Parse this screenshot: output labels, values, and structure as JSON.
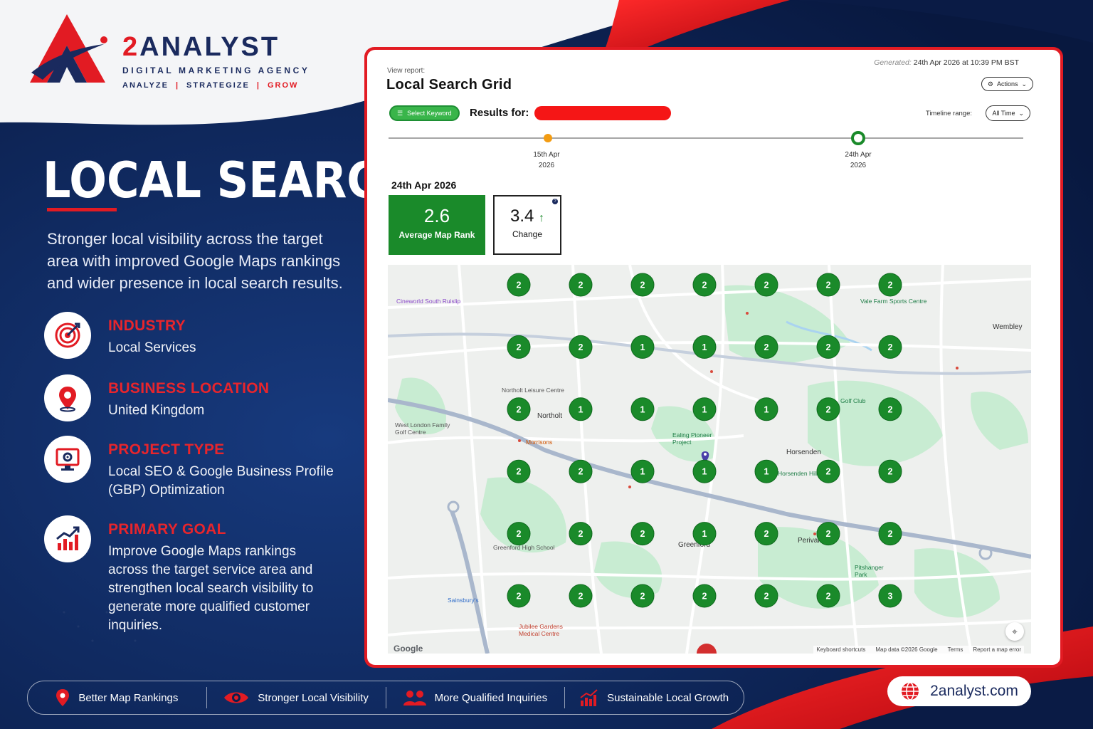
{
  "brand": {
    "name_prefix": "2",
    "name": "ANALYST",
    "subtitle": "DIGITAL MARKETING AGENCY",
    "tagline": [
      "ANALYZE",
      "STRATEGIZE",
      "GROW"
    ]
  },
  "headline": "LOCAL SEARCH GRID",
  "lead": "Stronger local visibility across the target area with improved Google Maps rankings and wider presence in local search results.",
  "info": [
    {
      "title": "INDUSTRY",
      "body": "Local Services",
      "icon": "target-icon"
    },
    {
      "title": "BUSINESS LOCATION",
      "body": "United Kingdom",
      "icon": "location-pin-icon"
    },
    {
      "title": "PROJECT TYPE",
      "body": "Local SEO & Google Business Profile (GBP) Optimization",
      "icon": "monitor-gear-icon"
    },
    {
      "title": "PRIMARY GOAL",
      "body": "Improve Google Maps rankings across the target service area and strengthen local search visibility to generate more qualified customer inquiries.",
      "icon": "growth-chart-icon"
    }
  ],
  "report": {
    "view_report_label": "View report:",
    "title": "Local Search Grid",
    "generated_label": "Generated:",
    "generated_value": "24th Apr 2026 at 10:39 PM BST",
    "actions_label": "Actions",
    "select_keyword_label": "Select Keyword",
    "results_for_label": "Results for:",
    "timeline_range_label": "Timeline range:",
    "timeline_range_value": "All Time",
    "timeline": [
      {
        "day": "15th Apr",
        "year": "2026",
        "color": "#f39c12"
      },
      {
        "day": "24th Apr",
        "year": "2026",
        "color": "#1a8a2a"
      }
    ],
    "date_heading": "24th Apr 2026",
    "average_map_rank": {
      "value": "2.6",
      "label": "Average Map Rank"
    },
    "change": {
      "value": "3.4",
      "label": "Change",
      "arrow": "↑"
    }
  },
  "map": {
    "grid": [
      [
        2,
        2,
        2,
        2,
        2,
        2,
        2
      ],
      [
        2,
        2,
        1,
        1,
        2,
        2,
        2
      ],
      [
        2,
        1,
        1,
        1,
        1,
        2,
        2
      ],
      [
        2,
        2,
        1,
        1,
        1,
        2,
        2
      ],
      [
        2,
        2,
        2,
        1,
        2,
        2,
        2
      ],
      [
        2,
        2,
        2,
        2,
        2,
        2,
        3
      ]
    ],
    "marker_color": "#1a8a2a",
    "labels": [
      {
        "text": "Cineworld South Ruislip",
        "cls": "poi-p"
      },
      {
        "text": "Vale Farm Sports Centre",
        "cls": "poi-g"
      },
      {
        "text": "Northolt",
        "cls": "big"
      },
      {
        "text": "Northolt Leisure Centre",
        "cls": ""
      },
      {
        "text": "West London Family Golf Centre",
        "cls": ""
      },
      {
        "text": "Morrisons",
        "cls": "poi-o"
      },
      {
        "text": "Horsenden",
        "cls": "big"
      },
      {
        "text": "Golf Club",
        "cls": "poi-g"
      },
      {
        "text": "Ealing Pioneer Project",
        "cls": "poi-g"
      },
      {
        "text": "Greenford High School",
        "cls": ""
      },
      {
        "text": "Greenford",
        "cls": "big"
      },
      {
        "text": "Perivale",
        "cls": "big"
      },
      {
        "text": "Pitshanger Park",
        "cls": "poi-g"
      },
      {
        "text": "Jubilee Gardens Medical Centre",
        "cls": "poi-r"
      },
      {
        "text": "Sainsbury's",
        "cls": "poi-b"
      },
      {
        "text": "Wembley",
        "cls": "big"
      },
      {
        "text": "Horsenden Hill",
        "cls": "poi-g"
      }
    ],
    "footer": [
      "Keyboard shortcuts",
      "Map data ©2026 Google",
      "Terms",
      "Report a map error"
    ],
    "google_label": "Google"
  },
  "features": [
    {
      "label": "Better Map Rankings",
      "icon": "pin-icon"
    },
    {
      "label": "Stronger Local Visibility",
      "icon": "eye-icon"
    },
    {
      "label": "More Qualified Inquiries",
      "icon": "people-icon"
    },
    {
      "label": "Sustainable Local Growth",
      "icon": "growth-icon"
    }
  ],
  "website": "2analyst.com",
  "colors": {
    "navy": "#0c1f4e",
    "red": "#e21b23",
    "green": "#1a8a2a"
  }
}
